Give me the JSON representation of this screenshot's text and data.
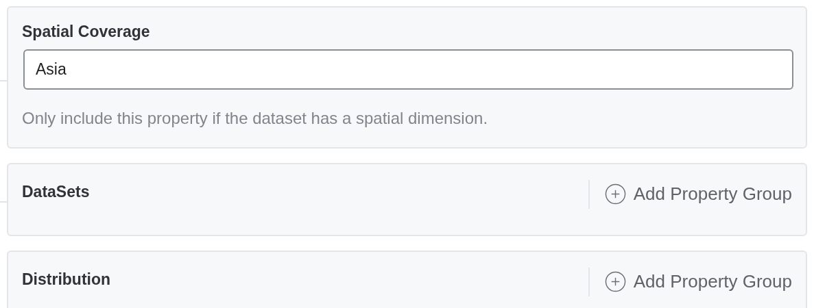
{
  "sections": [
    {
      "kind": "field",
      "title": "Spatial Coverage",
      "value": "Asia",
      "help": "Only include this property if the dataset has a spatial dimension."
    },
    {
      "kind": "group",
      "title": "DataSets",
      "action": "Add Property Group"
    },
    {
      "kind": "group",
      "title": "Distribution",
      "action": "Add Property Group"
    }
  ]
}
